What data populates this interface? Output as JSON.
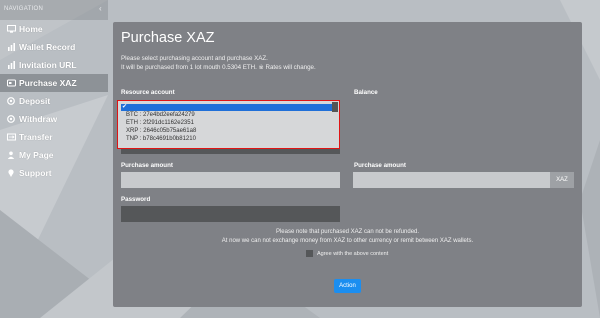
{
  "sidebar": {
    "header": "NAVIGATION",
    "items": [
      {
        "label": "Home",
        "icon": "monitor-icon"
      },
      {
        "label": "Wallet Record",
        "icon": "bar-chart-icon"
      },
      {
        "label": "Invitation URL",
        "icon": "bar-chart-icon"
      },
      {
        "label": "Purchase XAZ",
        "icon": "card-icon",
        "active": true
      },
      {
        "label": "Deposit",
        "icon": "gear-icon"
      },
      {
        "label": "Withdraw",
        "icon": "gear-icon"
      },
      {
        "label": "Transfer",
        "icon": "transfer-icon"
      },
      {
        "label": "My Page",
        "icon": "user-icon"
      },
      {
        "label": "Support",
        "icon": "pin-icon"
      }
    ]
  },
  "main": {
    "title": "Purchase XAZ",
    "intro_line1": "Please select purchasing account and purchase XAZ.",
    "intro_line2": "It will be purchased from 1 lot mouth 0.5304 ETH. ※ Rates will change.",
    "resource_account_label": "Resource account",
    "balance_label": "Balance",
    "dropdown": {
      "selected": "✔",
      "options": [
        "BTC : 27e4bd2eefa24279",
        "ETH : 2f291dc1162e2351",
        "XRP : 2646c05b75ae61a8",
        "TNP : b78c4691b0b81210"
      ]
    },
    "purchase_amount_label": "Purchase amount",
    "purchase_amount_label_right": "Purchase amount",
    "xaz_unit": "XAZ",
    "password_label": "Password",
    "notice_line1": "Please note that purchased XAZ can not be refunded.",
    "notice_line2": "At now we can not exchange money from XAZ to other currency or remit between XAZ wallets.",
    "agree_label": "Agree with the above content",
    "action_button": "Action"
  },
  "colors": {
    "background": "#b9bec3",
    "panel": "#7f8186",
    "active_nav": "#8d9297",
    "dropdown_border": "#e01414",
    "dropdown_selected": "#1f6fd8",
    "action_button": "#1b8ef0"
  }
}
